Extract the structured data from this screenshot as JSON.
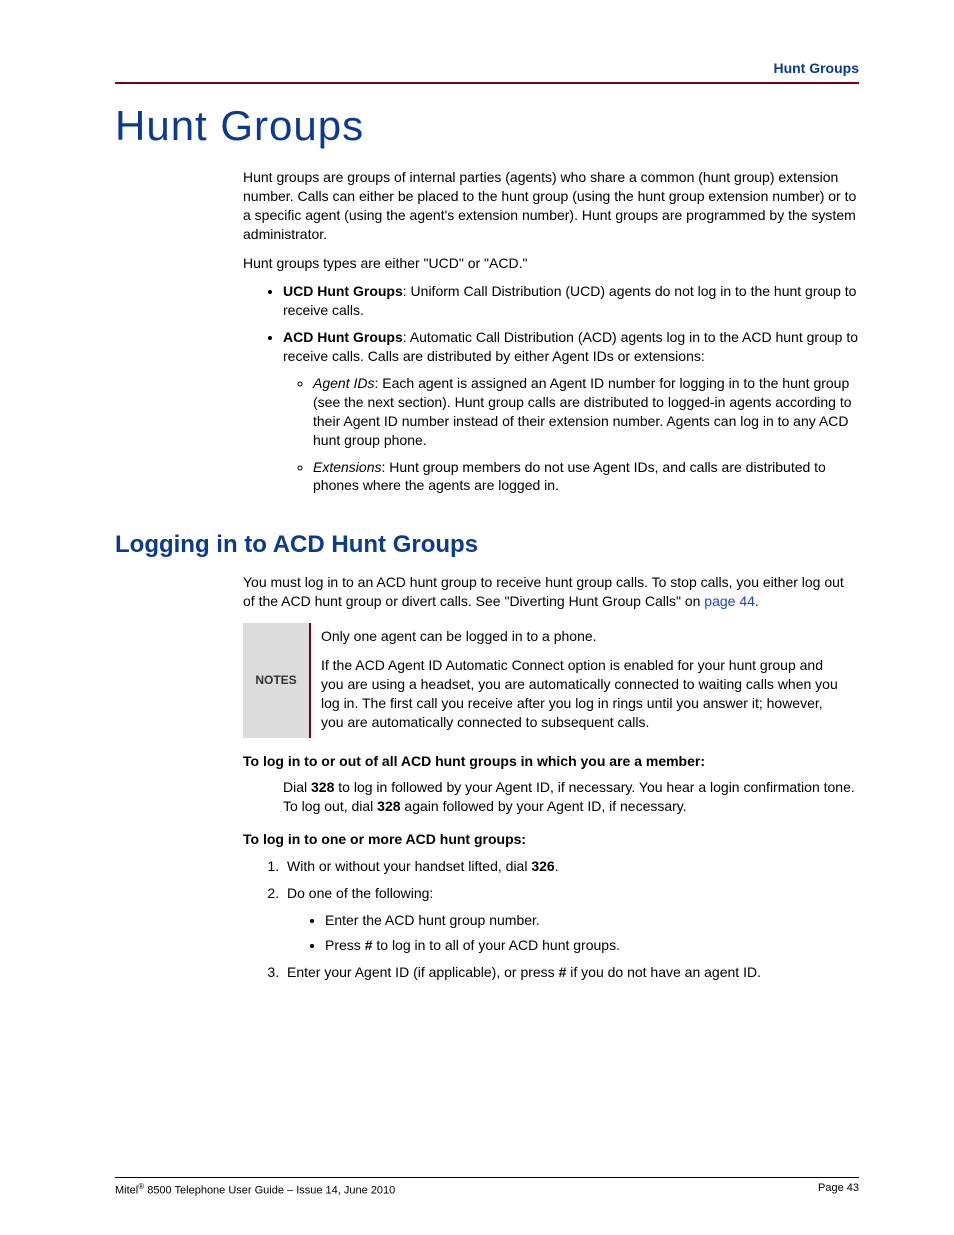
{
  "header_label": "Hunt Groups",
  "main_title": "Hunt Groups",
  "intro_p1": "Hunt groups are groups of internal parties (agents) who share a common (hunt group) extension number. Calls can either be placed to the hunt group (using the hunt group extension number) or to a specific agent (using the agent's extension number). Hunt groups are programmed by the system administrator.",
  "intro_p2": "Hunt groups types are either \"UCD\" or \"ACD.\"",
  "ucd_label": "UCD Hunt Groups",
  "ucd_text": ": Uniform Call Distribution (UCD) agents do not log in to the hunt group to receive calls.",
  "acd_label": "ACD Hunt Groups",
  "acd_text": ": Automatic Call Distribution (ACD) agents log in to the ACD hunt group to receive calls. Calls are distributed by either Agent IDs or extensions:",
  "agent_ids_label": "Agent IDs",
  "agent_ids_text": ": Each agent is assigned an Agent ID number for logging in to the hunt group (see the next section). Hunt group calls are distributed to logged-in agents according to their Agent ID number instead of their extension number. Agents can log in to any ACD hunt group phone.",
  "extensions_label": "Extensions",
  "extensions_text": ": Hunt group members do not use Agent IDs, and calls are distributed to phones where the agents are logged in.",
  "section_title": "Logging in to ACD Hunt Groups",
  "login_intro_a": "You must log in to an ACD hunt group to receive hunt group calls. To stop calls, you either log out of the ACD hunt group or divert calls. See \"Diverting Hunt Group Calls\" on ",
  "login_intro_link": "page 44",
  "login_intro_b": ".",
  "notes_label": "NOTES",
  "note1": "Only one agent can be logged in to a phone.",
  "note2": "If the ACD Agent ID Automatic Connect option is enabled for your hunt group and you are using a headset, you are automatically connected to waiting calls when you log in. The first call you receive after you log in rings until you answer it; however, you are automatically connected to subsequent calls.",
  "proc1_head": "To log in to or out of all ACD hunt groups in which you are a member:",
  "proc1_a": "Dial ",
  "proc1_code1": "328",
  "proc1_b": " to log in followed by your Agent ID, if necessary. You hear a login confirmation tone. To log out, dial ",
  "proc1_code2": "328",
  "proc1_c": " again followed by your Agent ID, if necessary.",
  "proc2_head": "To log in to one or more ACD hunt groups:",
  "step1_a": "With or without your handset lifted, dial ",
  "step1_code": "326",
  "step1_b": ".",
  "step2": "Do one of the following:",
  "step2_bullet1": "Enter the ACD hunt group number.",
  "step2_bullet2_a": "Press ",
  "step2_bullet2_hash": "#",
  "step2_bullet2_b": " to log in to all of your ACD hunt groups.",
  "step3_a": "Enter your Agent ID (if applicable), or press ",
  "step3_hash": "#",
  "step3_b": " if you do not have an agent ID.",
  "footer_left_a": "Mitel",
  "footer_left_b": " 8500 Telephone User Guide – Issue 14, June 2010",
  "footer_right": "Page 43"
}
